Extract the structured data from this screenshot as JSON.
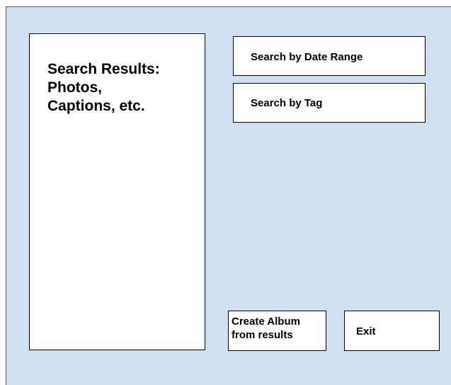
{
  "results_panel": {
    "label": "Search Results:\nPhotos,\nCaptions, etc."
  },
  "buttons": {
    "search_date": "Search by Date Range",
    "search_tag": "Search by Tag",
    "create_album": "Create Album\nfrom results",
    "exit": "Exit"
  },
  "colors": {
    "background": "#cfe0f3",
    "panel": "#ffffff",
    "border": "#000000"
  }
}
